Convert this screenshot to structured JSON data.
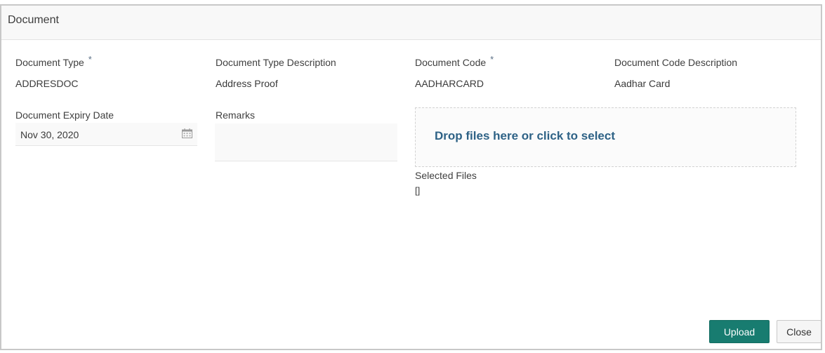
{
  "dialog": {
    "title": "Document"
  },
  "fields": {
    "document_type": {
      "label": "Document Type",
      "required_mark": "*",
      "value": "ADDRESDOC"
    },
    "document_type_description": {
      "label": "Document Type Description",
      "value": "Address Proof"
    },
    "document_code": {
      "label": "Document Code",
      "required_mark": "*",
      "value": "AADHARCARD"
    },
    "document_code_description": {
      "label": "Document Code Description",
      "value": "Aadhar Card"
    },
    "document_expiry_date": {
      "label": "Document Expiry Date",
      "value": "Nov 30, 2020",
      "icon": "calendar-icon"
    },
    "remarks": {
      "label": "Remarks",
      "value": ""
    }
  },
  "upload": {
    "dropzone_text": "Drop files here or click to select",
    "selected_files_label": "Selected Files",
    "selected_files_value": "[]"
  },
  "buttons": {
    "upload_label": "Upload",
    "close_label": "Close"
  },
  "colors": {
    "upload_button": "#187c70",
    "dropzone_text": "#2e6286",
    "required_mark": "#5b6f86"
  }
}
